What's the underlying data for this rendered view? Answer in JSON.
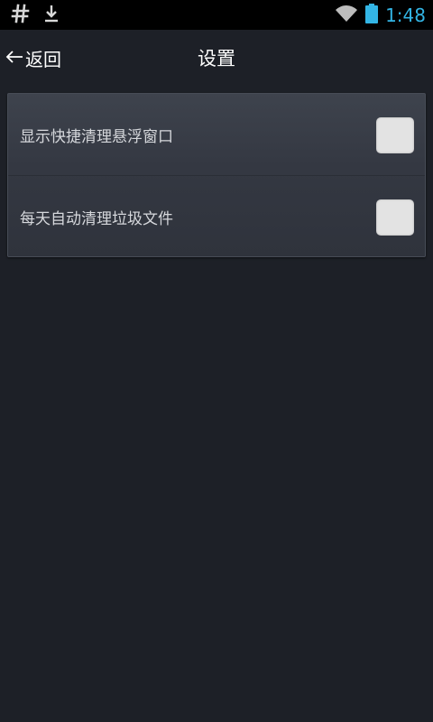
{
  "status_bar": {
    "time": "1:48",
    "accent_color": "#33b5e5",
    "icons": [
      "hash-icon",
      "download-icon",
      "wifi-icon",
      "battery-icon"
    ]
  },
  "header": {
    "back_label": "返回",
    "title": "设置"
  },
  "settings": {
    "items": [
      {
        "label": "显示快捷清理悬浮窗口",
        "checked": false
      },
      {
        "label": "每天自动清理垃圾文件",
        "checked": false
      }
    ]
  },
  "colors": {
    "background": "#1d2027",
    "panel": "#3a3e48",
    "checkbox": "#e3e3e3"
  }
}
